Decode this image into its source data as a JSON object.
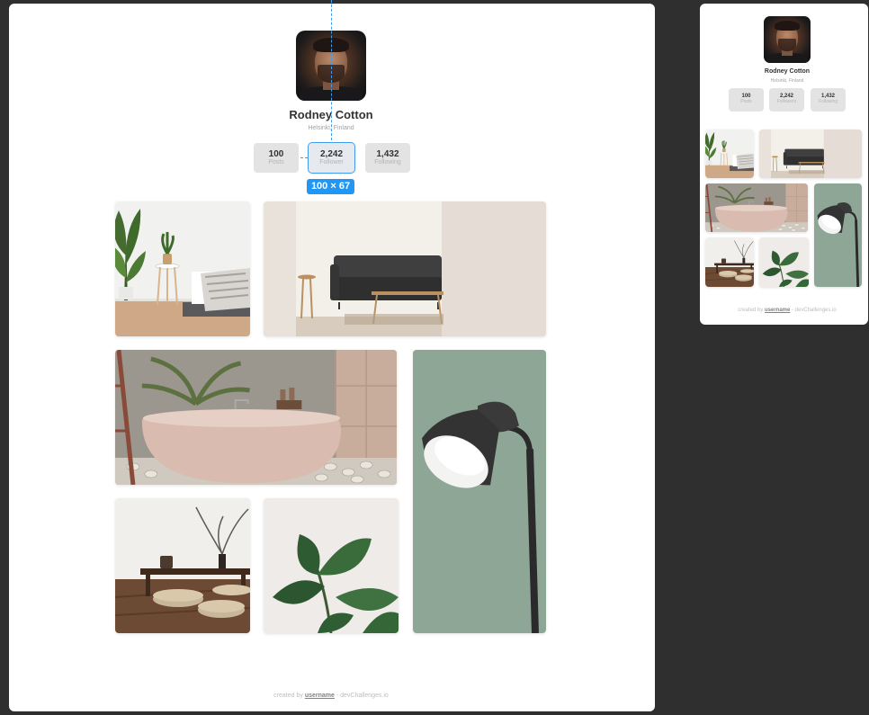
{
  "profile": {
    "name": "Rodney Cotton",
    "location": "Helsinki, Finland"
  },
  "stats": [
    {
      "value": "100",
      "label": "Posts"
    },
    {
      "value": "2,242",
      "label": "Follower"
    },
    {
      "value": "1,432",
      "label": "Following"
    }
  ],
  "mobile_stats": [
    {
      "value": "100",
      "label": "Posts"
    },
    {
      "value": "2,242",
      "label": "Followers"
    },
    {
      "value": "1,432",
      "label": "Following"
    }
  ],
  "measure": {
    "badge": "100 × 67",
    "color": "#2196f3"
  },
  "footer": {
    "prefix": "created by",
    "user": "username",
    "suffix": "- devChallenges.io"
  },
  "gallery": [
    {
      "name": "living-room-plant-photo",
      "subject": "plant-icon"
    },
    {
      "name": "sofa-photo",
      "subject": "sofa-icon"
    },
    {
      "name": "bathtub-photo",
      "subject": "bathtub-icon"
    },
    {
      "name": "lamp-photo",
      "subject": "lamp-icon"
    },
    {
      "name": "low-table-photo",
      "subject": "table-icon"
    },
    {
      "name": "rubber-plant-photo",
      "subject": "leaf-icon"
    }
  ],
  "colors": {
    "background": "#2f2f2f",
    "card": "#ffffff",
    "accent": "#3d9cf0",
    "stat_bg": "#e3e3e3"
  }
}
